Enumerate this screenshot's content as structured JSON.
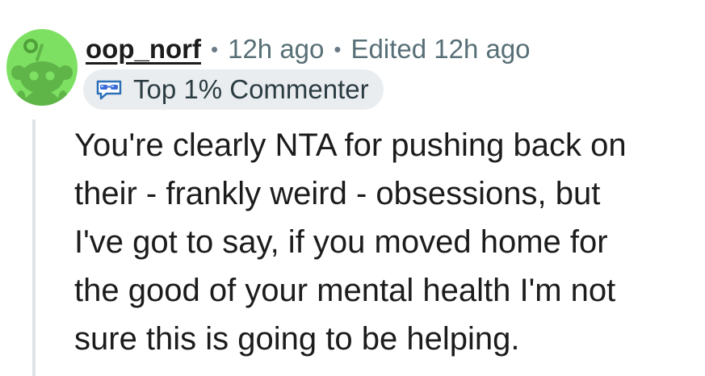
{
  "comment": {
    "author": "oop_norf",
    "timestamp": "12h ago",
    "edited": "Edited 12h ago",
    "separator": "•",
    "flair": "Top 1% Commenter",
    "body_lines": [
      "You're clearly NTA for pushing back on",
      "their - frankly weird - obsessions, but",
      "I've got to say, if you moved home for",
      "the good of your mental health I'm not",
      "sure this is going to be helping."
    ]
  },
  "colors": {
    "avatar_bg": "#7ee063",
    "badge_bg": "#eaedef",
    "meta_text": "#576f76",
    "thread_line": "#dfe3e6"
  },
  "icons": {
    "avatar": "snoo-avatar-icon",
    "flair": "top-commenter-badge-icon"
  }
}
